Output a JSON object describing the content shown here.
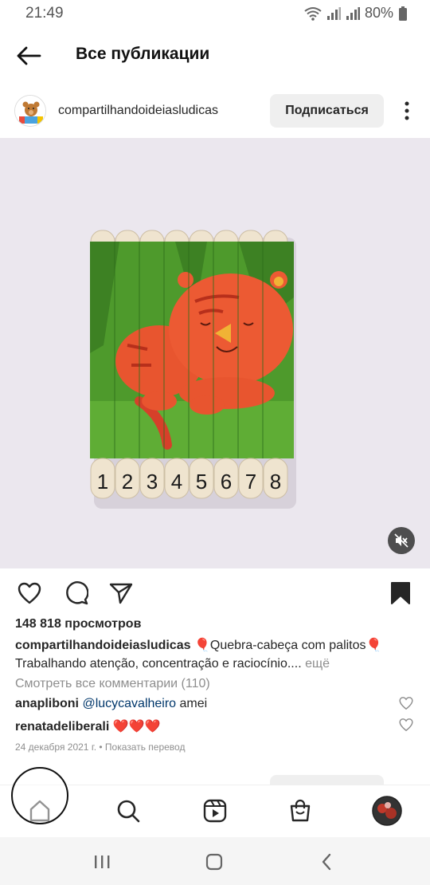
{
  "status_bar": {
    "time": "21:49",
    "battery": "80%"
  },
  "header": {
    "title": "Все публикации"
  },
  "post": {
    "username": "compartilhandoideiasludicas",
    "follow_label": "Подписаться",
    "puzzle_numbers": [
      "1",
      "2",
      "3",
      "4",
      "5",
      "6",
      "7",
      "8"
    ],
    "views": "148 818 просмотров",
    "caption_user": "compartilhandoideiasludicas",
    "caption_text": " 🎈Quebra-cabeça com palitos🎈 Trabalhando atenção, concentração e raciocínio....",
    "caption_more": " ещё",
    "view_comments": "Смотреть все комментарии (110)",
    "comments": [
      {
        "user": "anapliboni",
        "mention": "@lucycavalheiro",
        "text": " amei"
      },
      {
        "user": "renatadeliberali",
        "mention": "",
        "text": " ❤️❤️❤️"
      }
    ],
    "date": "24 декабря 2021 г. • Показать перевод"
  },
  "icons": {
    "back": "arrow-left-icon",
    "more": "more-vertical-icon",
    "like": "heart-icon",
    "comment": "comment-icon",
    "share": "send-icon",
    "save": "bookmark-icon",
    "mute": "muted-speaker-icon",
    "home": "home-icon",
    "search": "search-icon",
    "reels": "reels-icon",
    "shop": "shop-bag-icon",
    "profile": "profile-avatar-icon"
  },
  "colors": {
    "link": "#00376b",
    "muted": "#8e8e8e",
    "button_bg": "#efefef",
    "text": "#262626"
  }
}
